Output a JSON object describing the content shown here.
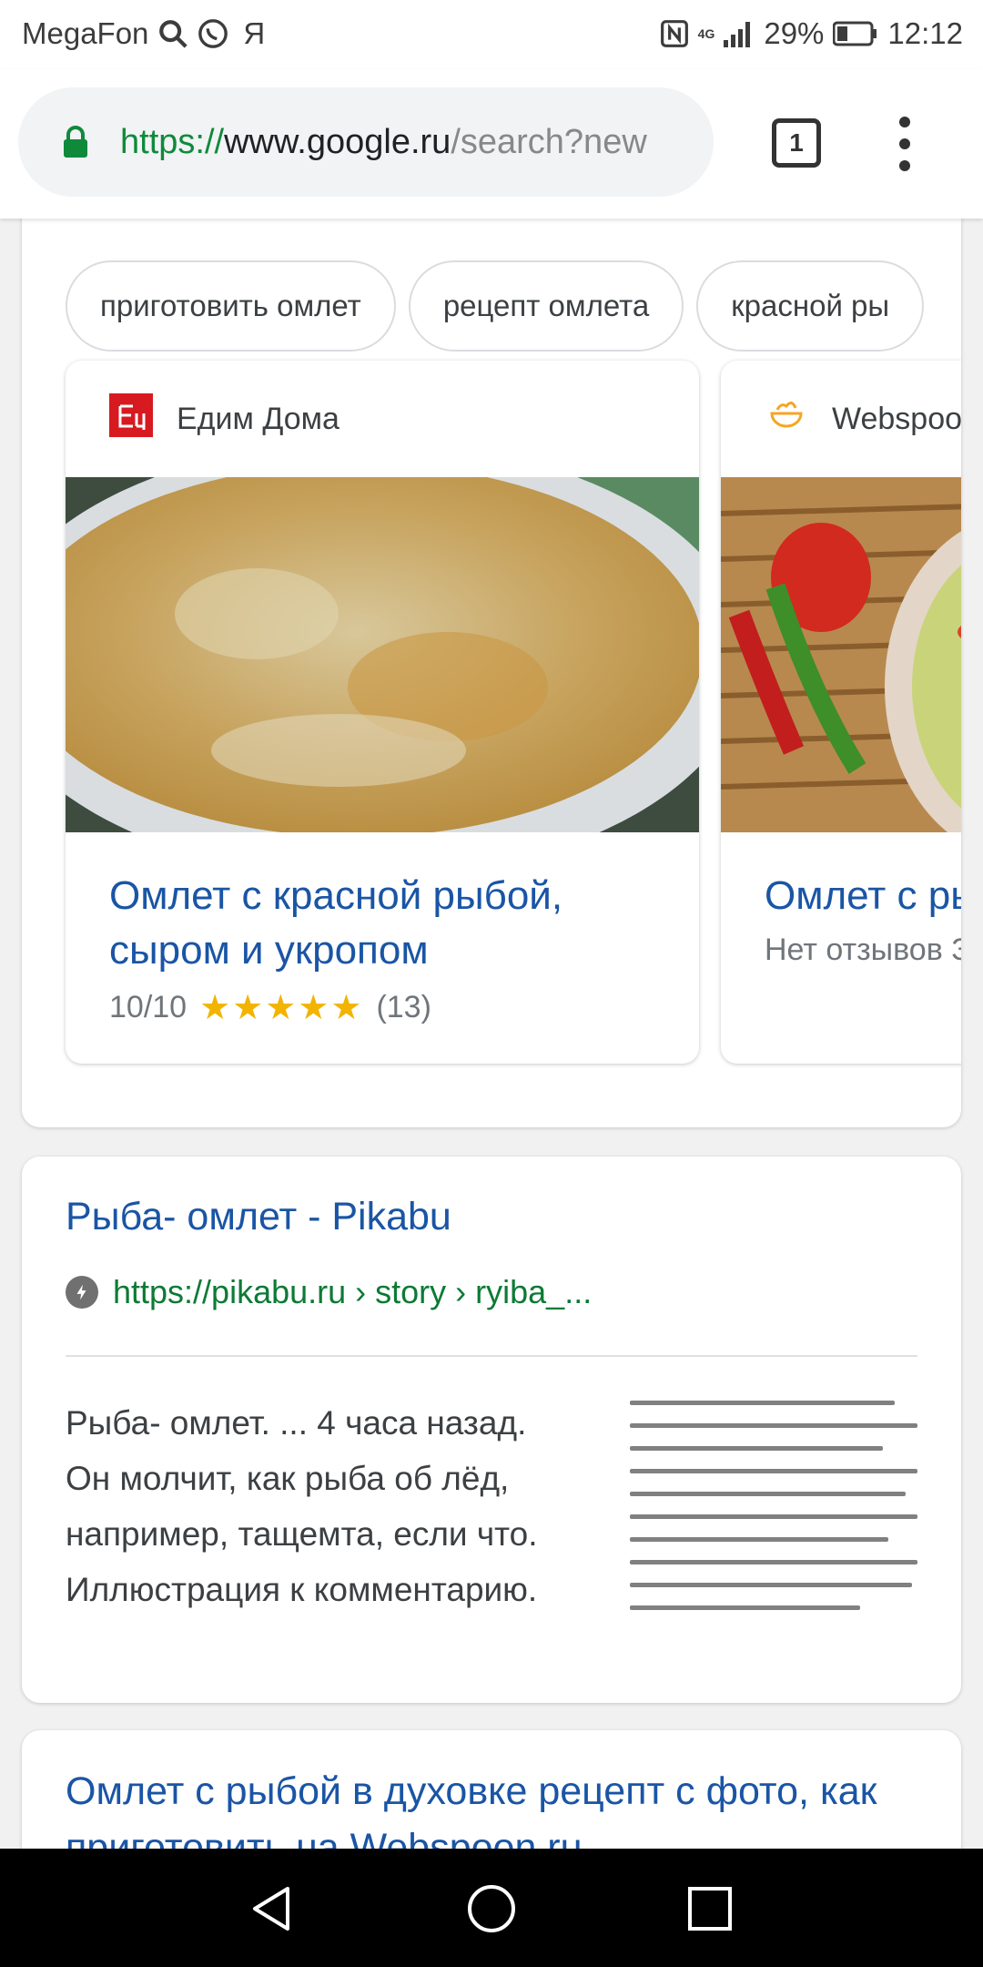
{
  "status_bar": {
    "carrier": "MegaFon",
    "yandex_glyph": "Я",
    "network": "4G",
    "battery": "29%",
    "time": "12:12"
  },
  "browser": {
    "url_scheme": "https://",
    "url_host": "www.google.ru",
    "url_path": "/search?new",
    "tab_count": "1"
  },
  "suggestions": [
    "приготовить омлет",
    "рецепт омлета",
    "красной ры"
  ],
  "recipes": [
    {
      "source": "Едим Дома",
      "title": "Омлет с красной рыбой, сыром и укропом",
      "score": "10/10",
      "stars": "★★★★★",
      "rating_count": "(13)"
    },
    {
      "source": "Webspoon",
      "title": "Омлет с ры",
      "reviews": "Нет отзывов З"
    }
  ],
  "result1": {
    "title": "Рыба- омлет - Pikabu",
    "url": "https://pikabu.ru › story › ryiba_...",
    "snippet": "Рыба- омлет. ... 4 часа назад. Он молчит, как рыба об лёд, например, тащемта, если что. Иллюстрация к комментарию."
  },
  "result2": {
    "title": "Омлет с рыбой в духовке рецепт с фото, как приготовить на Webspoon.ru"
  },
  "colors": {
    "link_blue": "#1a55a5",
    "url_green": "#0d7a35",
    "star_gold": "#f2b400",
    "lock_green": "#0f8a3b"
  },
  "icons": [
    "search-icon",
    "whatsapp-icon",
    "nfc-icon",
    "signal-icon",
    "battery-icon",
    "lock-icon",
    "tabs-icon",
    "more-vert-icon",
    "amp-icon",
    "back-icon",
    "home-icon",
    "recents-icon"
  ]
}
